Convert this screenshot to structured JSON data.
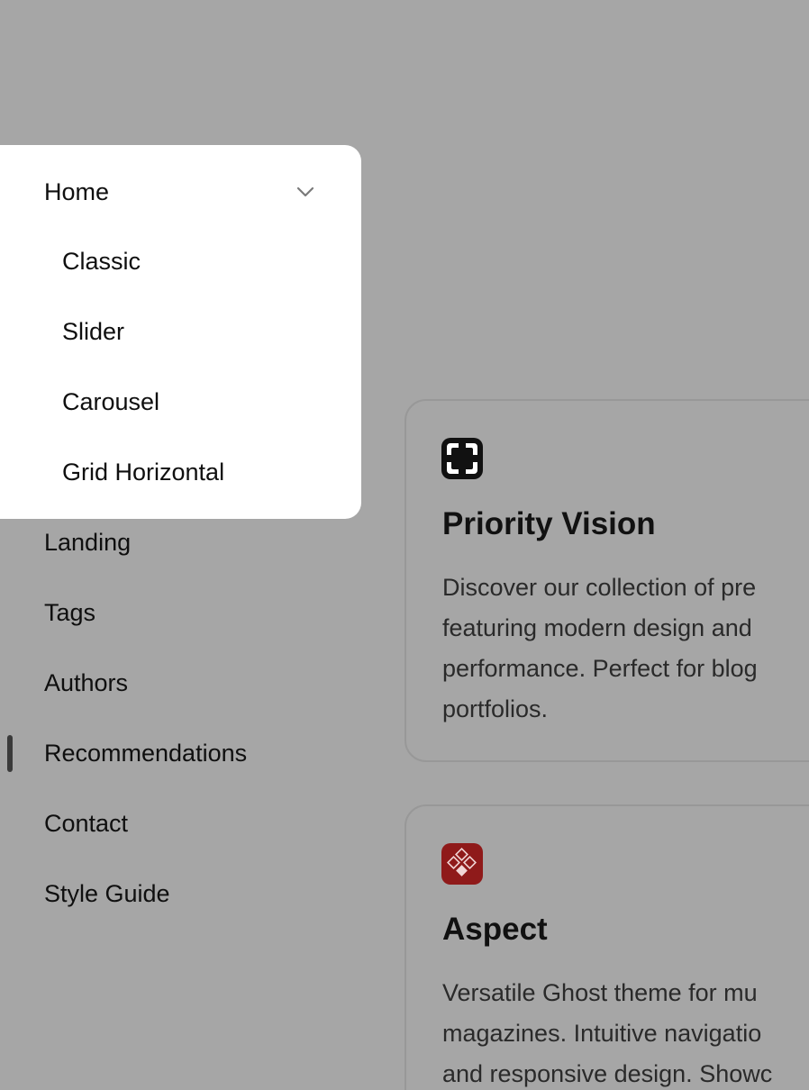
{
  "sidebar": {
    "items": [
      {
        "label": "Landing"
      },
      {
        "label": "Tags"
      },
      {
        "label": "Authors"
      },
      {
        "label": "Recommendations"
      },
      {
        "label": "Contact"
      },
      {
        "label": "Style Guide"
      }
    ],
    "active_item": "Recommendations"
  },
  "dropdown": {
    "parent_label": "Home",
    "chevron_icon": "chevron-down-icon",
    "items": [
      {
        "label": "Classic"
      },
      {
        "label": "Slider"
      },
      {
        "label": "Carousel"
      },
      {
        "label": "Grid Horizontal"
      }
    ]
  },
  "cards": [
    {
      "icon": "focus-frame-icon",
      "icon_color": "#111111",
      "title": "Priority Vision",
      "description_lines": [
        "Discover our collection of pre",
        "featuring modern design and",
        "performance. Perfect for blog",
        "portfolios."
      ]
    },
    {
      "icon": "diamond-grid-icon",
      "icon_color": "#8f1a1a",
      "title": "Aspect",
      "description_lines": [
        "Versatile Ghost theme for mu",
        "magazines. Intuitive navigatio",
        "and responsive design. Showc"
      ]
    }
  ],
  "colors": {
    "background": "#a6a6a6",
    "dropdown_bg": "#ffffff",
    "active_indicator": "#3a3a3a"
  }
}
